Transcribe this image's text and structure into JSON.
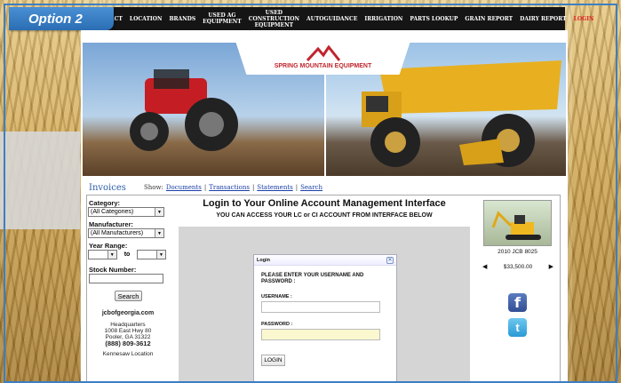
{
  "badge": {
    "label": "Option 2"
  },
  "nav": {
    "items": [
      {
        "label": "ACT"
      },
      {
        "label": "LOCATION"
      },
      {
        "label": "BRANDS"
      },
      {
        "label": "USED AG\nEQUIPMENT"
      },
      {
        "label": "USED CONSTRUCTION\nEQUIPMENT"
      },
      {
        "label": "AUTOGUIDANCE"
      },
      {
        "label": "IRRIGATION"
      },
      {
        "label": "PARTS LOOKUP"
      },
      {
        "label": "GRAIN REPORT"
      },
      {
        "label": "DAIRY REPORT"
      },
      {
        "label": "LOGIN"
      }
    ]
  },
  "brand": {
    "name": "SPRING MOUNTAIN EQUIPMENT"
  },
  "tabs": {
    "title": "Invoices",
    "show_label": "Show:",
    "links": [
      "Documents",
      "Transactions",
      "Statements",
      "Search"
    ]
  },
  "filters": {
    "category_label": "Category:",
    "category_value": "(All Categories)",
    "manufacturer_label": "Manufacturer:",
    "manufacturer_value": "(All Manufacturers)",
    "year_label": "Year Range:",
    "year_to": "to",
    "stock_label": "Stock Number:",
    "search_button": "Search"
  },
  "dealer": {
    "site": "jcbofgeorgia.com",
    "hq_title": "Headquarters",
    "hq_address1": "1008 East Hwy 80",
    "hq_address2": "Pooler, GA 31322",
    "hq_phone": "(888) 809-3612",
    "second_location": "Kennesaw Location"
  },
  "main": {
    "title": "Login to Your Online Account Management Interface",
    "subtitle": "YOU CAN ACCESS YOUR LC or CI ACCOUNT FROM INTERFACE BELOW"
  },
  "dialog": {
    "title": "Login",
    "message": "PLEASE ENTER YOUR USERNAME AND PASSWORD :",
    "username_label": "USERNAME :",
    "password_label": "PASSWORD :",
    "login_button": "LOGIN"
  },
  "featured": {
    "caption": "2010 JCB 8025",
    "price": "$33,500.00"
  },
  "colors": {
    "frame": "#3c7fc2",
    "nav_bg": "#151515",
    "login_red": "#e02020",
    "brand_red": "#c0262d"
  }
}
